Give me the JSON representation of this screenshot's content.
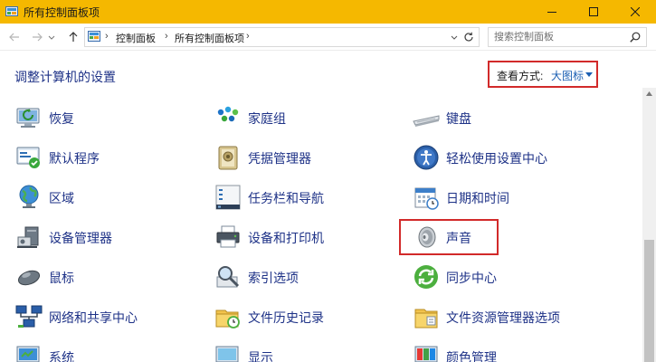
{
  "window": {
    "title": "所有控制面板项",
    "minimize_icon": "minimize-icon",
    "maximize_icon": "maximize-icon",
    "close_icon": "close-icon"
  },
  "address_bar": {
    "crumbs": [
      "控制面板",
      "所有控制面板项"
    ],
    "search_placeholder": "搜索控制面板"
  },
  "header": {
    "title": "调整计算机的设置",
    "view_label": "查看方式:",
    "view_value": "大图标"
  },
  "items": [
    {
      "label": "恢复",
      "icon": "recovery-icon"
    },
    {
      "label": "家庭组",
      "icon": "homegroup-icon"
    },
    {
      "label": "键盘",
      "icon": "keyboard-icon"
    },
    {
      "label": "默认程序",
      "icon": "default-programs-icon"
    },
    {
      "label": "凭据管理器",
      "icon": "credential-manager-icon"
    },
    {
      "label": "轻松使用设置中心",
      "icon": "ease-of-access-icon"
    },
    {
      "label": "区域",
      "icon": "region-icon"
    },
    {
      "label": "任务栏和导航",
      "icon": "taskbar-icon"
    },
    {
      "label": "日期和时间",
      "icon": "calendar-icon"
    },
    {
      "label": "设备管理器",
      "icon": "device-manager-icon"
    },
    {
      "label": "设备和打印机",
      "icon": "printer-icon"
    },
    {
      "label": "声音",
      "icon": "speaker-icon"
    },
    {
      "label": "鼠标",
      "icon": "mouse-icon"
    },
    {
      "label": "索引选项",
      "icon": "indexing-icon"
    },
    {
      "label": "同步中心",
      "icon": "sync-icon"
    },
    {
      "label": "网络和共享中心",
      "icon": "network-icon"
    },
    {
      "label": "文件历史记录",
      "icon": "file-history-icon"
    },
    {
      "label": "文件资源管理器选项",
      "icon": "folder-options-icon"
    },
    {
      "label": "系统",
      "icon": "system-icon"
    },
    {
      "label": "显示",
      "icon": "display-icon"
    },
    {
      "label": "颜色管理",
      "icon": "color-management-icon"
    }
  ],
  "colors": {
    "titlebar": "#f5b800",
    "link": "#1e3287",
    "highlight_border": "#d22a2a"
  }
}
